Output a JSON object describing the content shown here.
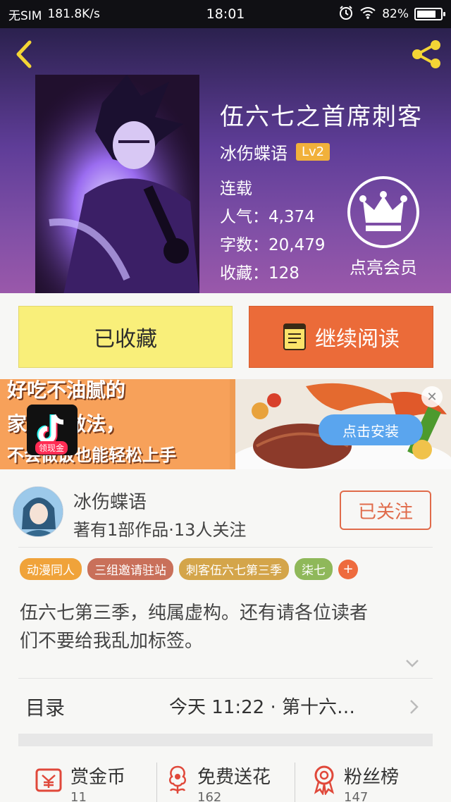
{
  "status_bar": {
    "carrier": "无SIM",
    "speed": "181.8K/s",
    "time": "18:01",
    "battery": "82%",
    "battery_level": 0.82
  },
  "hero": {
    "title": "伍六七之首席刺客",
    "author": "冰伤蝶语",
    "level": "Lv2",
    "status": "连载",
    "popularity": "人气：4,374",
    "word_count": "字数：20,479",
    "favorites": "收藏：128",
    "member_label": "点亮会员"
  },
  "actions": {
    "collected_label": "已收藏",
    "read_label": "继续阅读"
  },
  "ad": {
    "line1": "好吃不油腻的",
    "line2": "家常菜做法，",
    "line3": "不会做饭也能轻松上手",
    "tt_badge": "领现金",
    "install_label": "点击安装",
    "close_icon": "close-icon"
  },
  "author_section": {
    "name": "冰伤蝶语",
    "info": "著有1部作品·13人关注",
    "follow_label": "已关注"
  },
  "tags": [
    {
      "label": "动漫同人",
      "color": "#f0a33a"
    },
    {
      "label": "三组邀请驻站",
      "color": "#c9705a"
    },
    {
      "label": "刺客伍六七第三季",
      "color": "#d4a54a"
    },
    {
      "label": "柒七",
      "color": "#8fb85a"
    }
  ],
  "tags_more": "+",
  "description": {
    "line1": "伍六七第三季，纯属虚构。还有请各位读者",
    "line2": "们不要给我乱加标签。"
  },
  "toc": {
    "label": "目录",
    "latest": "今天 11:22 · 第十六…"
  },
  "bottom_stats": [
    {
      "label": "赏金币",
      "value": "11",
      "icon": "coin-icon"
    },
    {
      "label": "免费送花",
      "value": "162",
      "icon": "flower-icon"
    },
    {
      "label": "粉丝榜",
      "value": "147",
      "icon": "medal-icon"
    }
  ],
  "colors": {
    "accent": "#eb6b39",
    "collected_bg": "#f9ef7a",
    "follow": "#e06b4a"
  }
}
